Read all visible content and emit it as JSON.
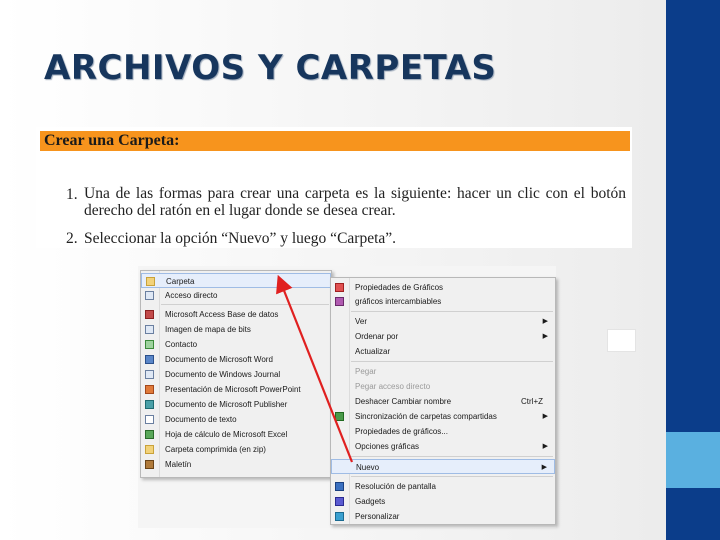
{
  "slide": {
    "title": "ARCHIVOS Y CARPETAS"
  },
  "document": {
    "header": "Crear una Carpeta:",
    "steps": [
      {
        "num": "1.",
        "text": "Una de las formas para crear una carpeta es la siguiente: hacer un clic con el botón derecho del ratón en el lugar donde se desea crear."
      },
      {
        "num": "2.",
        "text": "Seleccionar la opción “Nuevo” y luego “Carpeta”."
      }
    ]
  },
  "submenu_new": {
    "items": [
      {
        "label": "Carpeta",
        "icon": "folder-icon"
      },
      {
        "label": "Acceso directo",
        "icon": "shortcut-icon"
      },
      {
        "label": "Microsoft Access Base de datos",
        "icon": "access-icon"
      },
      {
        "label": "Imagen de mapa de bits",
        "icon": "bitmap-icon"
      },
      {
        "label": "Contacto",
        "icon": "contact-icon"
      },
      {
        "label": "Documento de Microsoft Word",
        "icon": "word-icon"
      },
      {
        "label": "Documento de Windows Journal",
        "icon": "journal-icon"
      },
      {
        "label": "Presentación de Microsoft PowerPoint",
        "icon": "powerpoint-icon"
      },
      {
        "label": "Documento de Microsoft Publisher",
        "icon": "publisher-icon"
      },
      {
        "label": "Documento de texto",
        "icon": "text-document-icon"
      },
      {
        "label": "Hoja de cálculo de Microsoft Excel",
        "icon": "excel-icon"
      },
      {
        "label": "Carpeta comprimida (en zip)",
        "icon": "zip-folder-icon"
      },
      {
        "label": "Maletín",
        "icon": "briefcase-icon"
      }
    ]
  },
  "context_menu": {
    "items": [
      {
        "label": "Propiedades de Gráficos",
        "icon": "graphics-icon"
      },
      {
        "label": "gráficos intercambiables",
        "icon": "switchable-graphics-icon"
      },
      {
        "label": "Ver",
        "submenu": true
      },
      {
        "label": "Ordenar por",
        "submenu": true
      },
      {
        "label": "Actualizar"
      },
      {
        "label": "Pegar",
        "disabled": true
      },
      {
        "label": "Pegar acceso directo",
        "disabled": true
      },
      {
        "label": "Deshacer Cambiar nombre",
        "shortcut": "Ctrl+Z"
      },
      {
        "label": "Sincronización de carpetas compartidas",
        "submenu": true,
        "icon": "sync-icon"
      },
      {
        "label": "Propiedades de gráficos..."
      },
      {
        "label": "Opciones gráficas",
        "submenu": true
      },
      {
        "label": "Nuevo",
        "submenu": true
      },
      {
        "label": "Resolución de pantalla",
        "icon": "screen-resolution-icon"
      },
      {
        "label": "Gadgets",
        "icon": "gadgets-icon"
      },
      {
        "label": "Personalizar",
        "icon": "personalize-icon"
      }
    ]
  },
  "colors": {
    "header_orange": "#f7941d",
    "title_blue": "#17365d",
    "sidebar": "#0b3d8a",
    "sidebar_accent": "#5ab0e0",
    "arrow": "#e02020"
  }
}
